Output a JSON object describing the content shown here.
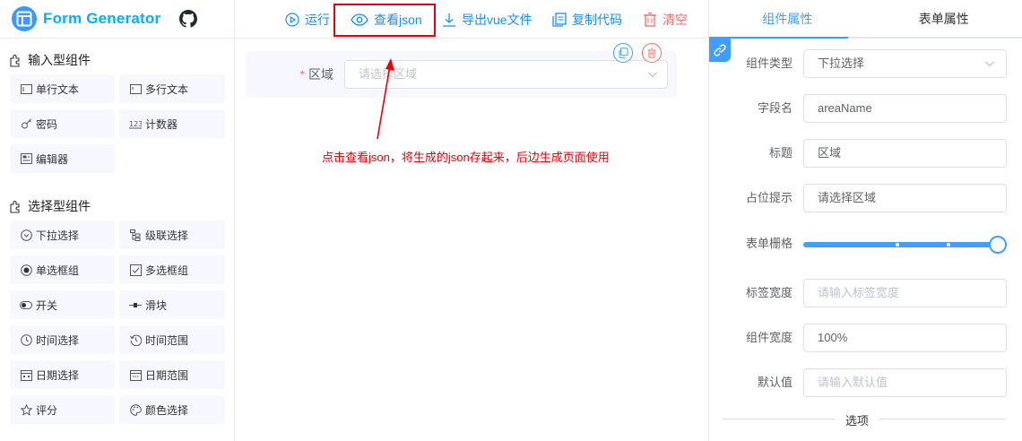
{
  "app": {
    "title": "Form Generator"
  },
  "components": {
    "input_group_title": "输入型组件",
    "input_items": [
      {
        "label": "单行文本",
        "icon": "input-icon"
      },
      {
        "label": "多行文本",
        "icon": "textarea-icon"
      },
      {
        "label": "密码",
        "icon": "password-icon"
      },
      {
        "label": "计数器",
        "icon": "number-icon"
      },
      {
        "label": "编辑器",
        "icon": "editor-icon"
      }
    ],
    "select_group_title": "选择型组件",
    "select_items": [
      {
        "label": "下拉选择",
        "icon": "select-icon"
      },
      {
        "label": "级联选择",
        "icon": "cascader-icon"
      },
      {
        "label": "单选框组",
        "icon": "radio-icon"
      },
      {
        "label": "多选框组",
        "icon": "checkbox-icon"
      },
      {
        "label": "开关",
        "icon": "switch-icon"
      },
      {
        "label": "滑块",
        "icon": "slider-icon"
      },
      {
        "label": "时间选择",
        "icon": "time-icon"
      },
      {
        "label": "时间范围",
        "icon": "time-range-icon"
      },
      {
        "label": "日期选择",
        "icon": "date-icon"
      },
      {
        "label": "日期范围",
        "icon": "date-range-icon"
      },
      {
        "label": "评分",
        "icon": "star-icon"
      },
      {
        "label": "颜色选择",
        "icon": "color-icon"
      }
    ]
  },
  "toolbar": {
    "run": "运行",
    "view_json": "查看json",
    "export_vue": "导出vue文件",
    "copy_code": "复制代码",
    "clear": "清空"
  },
  "canvas": {
    "field_label": "区域",
    "required_mark": "*",
    "field_placeholder": "请选择区域",
    "annotation": "点击查看json，将生成的json存起来，后边生成页面使用"
  },
  "right_panel": {
    "tabs": [
      "组件属性",
      "表单属性"
    ],
    "component_type": {
      "label": "组件类型",
      "value": "下拉选择"
    },
    "field_name": {
      "label": "字段名",
      "value": "areaName"
    },
    "title": {
      "label": "标题",
      "value": "区域"
    },
    "placeholder": {
      "label": "占位提示",
      "value": "请选择区域"
    },
    "span": {
      "label": "表单栅格",
      "value": 24,
      "max": 24
    },
    "label_width": {
      "label": "标签宽度",
      "placeholder": "请输入标签宽度"
    },
    "width": {
      "label": "组件宽度",
      "value": "100%"
    },
    "default_value": {
      "label": "默认值",
      "placeholder": "请输入默认值"
    },
    "options_divider": "选项"
  },
  "colors": {
    "primary": "#409eff",
    "brand": "#00afff",
    "danger": "#f56c6c",
    "annotation_red": "#e8000b",
    "item_bg": "#f6f7ff"
  }
}
